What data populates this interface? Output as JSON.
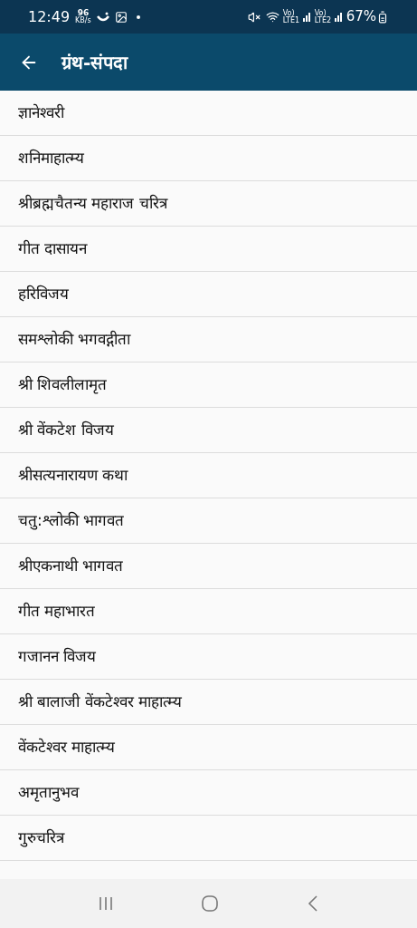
{
  "status_bar": {
    "time": "12:49",
    "net_speed": "96",
    "net_unit": "KB/s",
    "lte1": "Vo) LTE1",
    "lte2": "Vo) LTE2",
    "battery": "67%"
  },
  "header": {
    "title": "ग्रंथ-संपदा"
  },
  "items": [
    "ज्ञानेश्वरी",
    "शनिमाहात्म्य",
    "श्रीब्रह्मचैतन्य महाराज चरित्र",
    "गीत दासायन",
    "हरिविजय",
    "समश्लोकी भगवद्गीता",
    "श्री शिवलीलामृत",
    "श्री वेंकटेश विजय",
    "श्रीसत्यनारायण कथा",
    "चतु:श्लोकी भागवत",
    "श्रीएकनाथी भागवत",
    "गीत महाभारत",
    "गजानन विजय",
    "श्री बालाजी वेंकटेश्वर माहात्म्य",
    "वेंकटेश्वर माहात्म्य",
    "अमृतानुभव",
    "गुरुचरित्र"
  ]
}
